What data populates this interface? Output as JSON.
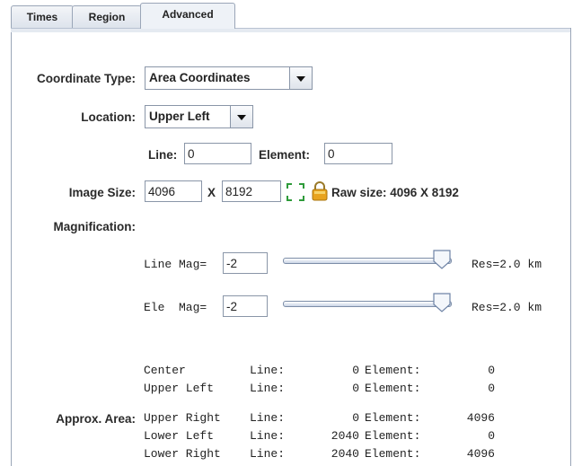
{
  "tabs": [
    {
      "label": "Times"
    },
    {
      "label": "Region"
    },
    {
      "label": "Advanced",
      "active": true
    }
  ],
  "coordinate_type": {
    "label": "Coordinate Type:",
    "value": "Area Coordinates"
  },
  "location": {
    "label": "Location:",
    "value": "Upper Left"
  },
  "line_element": {
    "line_label": "Line:",
    "line_value": "0",
    "element_label": "Element:",
    "element_value": "0"
  },
  "image_size": {
    "label": "Image Size:",
    "lines": "4096",
    "x_label": "X",
    "elements": "8192",
    "raw_size": "Raw size: 4096 X 8192",
    "icons": {
      "resize": "expand-arrows-icon",
      "lock": "lock-icon"
    },
    "lock_color": "#e8a31e",
    "expand_color": "#2e9b3a"
  },
  "magnification": {
    "label": "Magnification:",
    "line": {
      "label": "Line Mag=",
      "value": "-2",
      "res": "Res=2.0 km",
      "slider_level": 1.0
    },
    "ele": {
      "label": "Ele  Mag=",
      "value": "-2",
      "res": "Res=2.0 km",
      "slider_level": 1.0
    }
  },
  "approx_area": {
    "label": "Approx. Area:",
    "rows": [
      {
        "name": "Center",
        "line_label": "Line:",
        "line": "0",
        "element_label": "Element:",
        "element": "0"
      },
      {
        "name": "Upper Left",
        "line_label": "Line:",
        "line": "0",
        "element_label": "Element:",
        "element": "0"
      },
      {
        "name": "Upper Right",
        "line_label": "Line:",
        "line": "0",
        "element_label": "Element:",
        "element": "4096"
      },
      {
        "name": "Lower Left",
        "line_label": "Line:",
        "line": "2040",
        "element_label": "Element:",
        "element": "0"
      },
      {
        "name": "Lower Right",
        "line_label": "Line:",
        "line": "2040",
        "element_label": "Element:",
        "element": "4096"
      }
    ]
  }
}
